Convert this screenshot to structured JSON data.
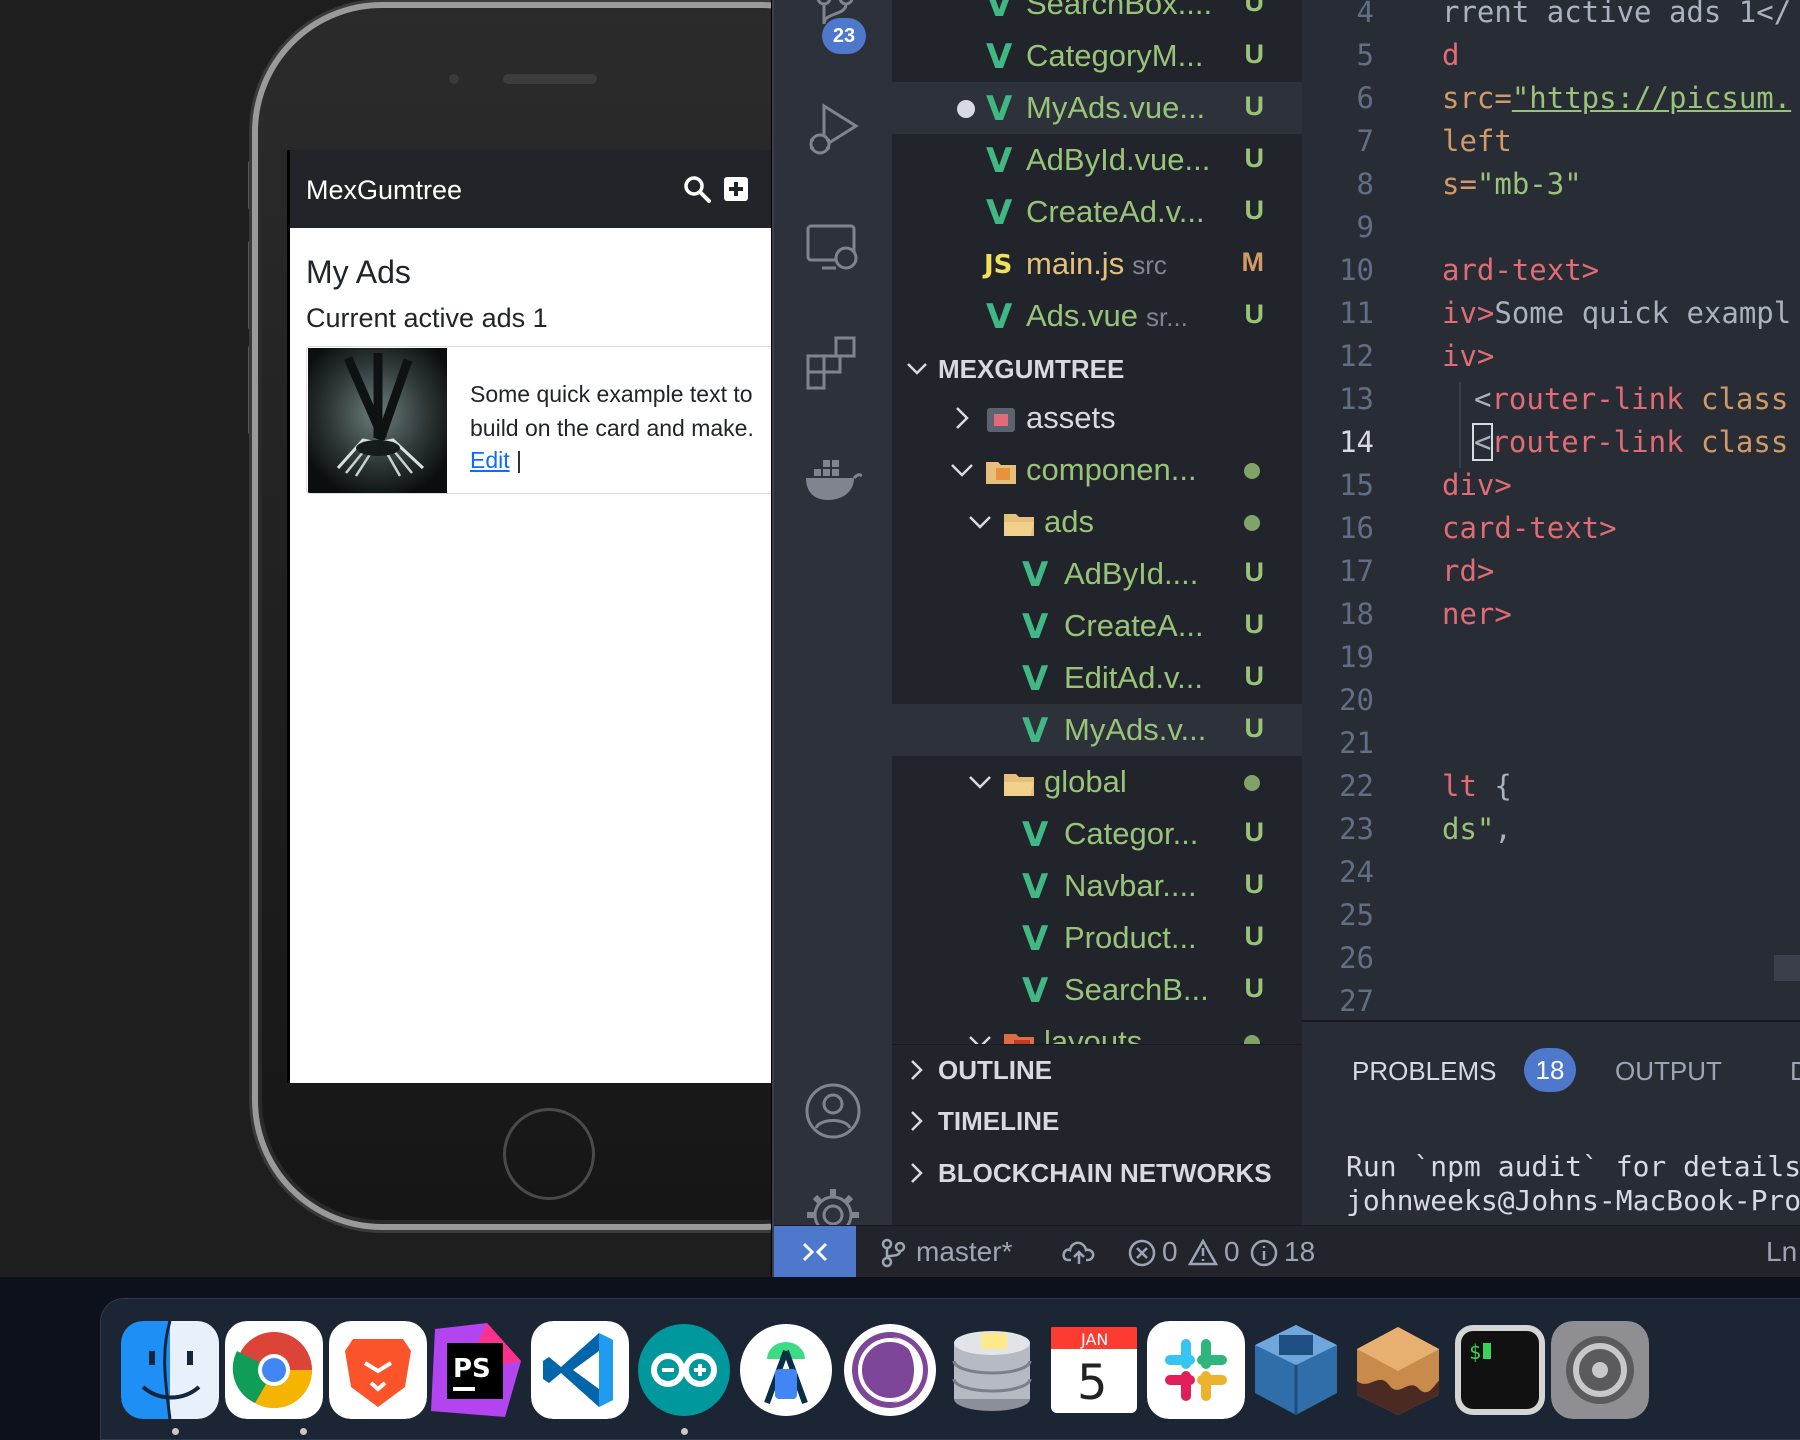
{
  "simulator": {
    "app": {
      "brand": "MexGumtree",
      "page_title": "My Ads",
      "page_subtitle": "Current active ads 1",
      "ad": {
        "text": "Some quick example text to build on the card and make.",
        "edit_label": "Edit",
        "separator": "|"
      }
    }
  },
  "vscode": {
    "scm_badge": "23",
    "open_editors": [
      {
        "icon": "vue-icon",
        "name": "SearchBox....",
        "status": "U"
      },
      {
        "icon": "vue-icon",
        "name": "CategoryM...",
        "status": "U"
      },
      {
        "icon": "vue-icon",
        "name": "MyAds.vue...",
        "status": "U"
      },
      {
        "icon": "vue-icon",
        "name": "AdById.vue...",
        "status": "U"
      },
      {
        "icon": "vue-icon",
        "name": "CreateAd.v...",
        "status": "U"
      },
      {
        "icon": "js-icon",
        "name": "main.js",
        "sub": "src",
        "status": "M"
      },
      {
        "icon": "vue-icon",
        "name": "Ads.vue",
        "sub": "sr...",
        "status": "U"
      }
    ],
    "js_label": "JS",
    "root_folder": "MEXGUMTREE",
    "tree": [
      {
        "name": "assets"
      },
      {
        "name": "componen..."
      },
      {
        "name": "ads"
      },
      {
        "name": "AdById....",
        "status": "U"
      },
      {
        "name": "CreateA...",
        "status": "U"
      },
      {
        "name": "EditAd.v...",
        "status": "U"
      },
      {
        "name": "MyAds.v...",
        "status": "U"
      },
      {
        "name": "global"
      },
      {
        "name": "Categor...",
        "status": "U"
      },
      {
        "name": "Navbar....",
        "status": "U"
      },
      {
        "name": "Product...",
        "status": "U"
      },
      {
        "name": "SearchB...",
        "status": "U"
      },
      {
        "name": "layouts"
      }
    ],
    "sections": {
      "outline": "OUTLINE",
      "timeline": "TIMELINE",
      "blockchain": "BLOCKCHAIN NETWORKS"
    },
    "editor": {
      "line_numbers": [
        "4",
        "5",
        "6",
        "7",
        "8",
        "9",
        "10",
        "11",
        "12",
        "13",
        "14",
        "15",
        "16",
        "17",
        "18",
        "19",
        "20",
        "21",
        "22",
        "23",
        "24",
        "25",
        "26",
        "27"
      ],
      "current_line": "14",
      "lines": {
        "l4": "rrent active ads 1</",
        "l5": "d",
        "l6a": "src=",
        "l6b": "\"https://picsum.",
        "l7": "left",
        "l8a": "s=",
        "l8b": "\"mb-3\"",
        "l10": "ard-text>",
        "l11a": "iv>",
        "l11b": "Some quick exampl",
        "l12": "iv>",
        "l13a": "<",
        "l13b": "router-link",
        "l13c": " class",
        "l14a": "<",
        "l14b": "router-link",
        "l14c": " class",
        "l15": "div>",
        "l16": "card-text>",
        "l17": "rd>",
        "l18": "ner>",
        "l22a": "lt",
        "l22b": " {",
        "l23a": "ds\"",
        "l23b": ","
      }
    },
    "panel": {
      "problems_label": "PROBLEMS",
      "problems_count": "18",
      "output_label": "OUTPUT",
      "more_label": "D",
      "terminal_lines": [
        "Run `npm audit` for details",
        "johnweeks@Johns-MacBook-Pro"
      ]
    },
    "statusbar": {
      "branch": "master*",
      "errors": "0",
      "warnings": "0",
      "infos": "18",
      "position": "Ln"
    }
  },
  "dock": {
    "apps": [
      "Finder",
      "Chrome",
      "Brave",
      "PhpStorm",
      "VS Code",
      "Arduino",
      "Android Studio",
      "Tor Browser",
      "Sequel Pro",
      "Calendar",
      "Slack",
      "VirtualBox",
      "Sublime Merge",
      "Terminal",
      "System Preferences"
    ],
    "calendar_month": "JAN",
    "calendar_day": "5",
    "terminal_glyph": "$",
    "ps_label": "PS"
  }
}
